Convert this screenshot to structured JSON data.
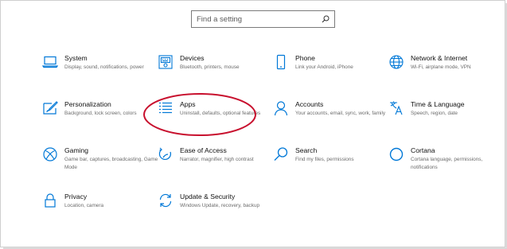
{
  "search": {
    "placeholder": "Find a setting",
    "icon": "search-icon"
  },
  "accent_color": "#0078d7",
  "annotation_color": "#c8102e",
  "tiles": [
    {
      "id": "system",
      "title": "System",
      "desc": "Display, sound, notifications, power",
      "icon": "laptop-icon"
    },
    {
      "id": "devices",
      "title": "Devices",
      "desc": "Bluetooth, printers, mouse",
      "icon": "keyboard-icon"
    },
    {
      "id": "phone",
      "title": "Phone",
      "desc": "Link your Android, iPhone",
      "icon": "phone-icon"
    },
    {
      "id": "network",
      "title": "Network & Internet",
      "desc": "Wi-Fi, airplane mode, VPN",
      "icon": "globe-icon"
    },
    {
      "id": "personalization",
      "title": "Personalization",
      "desc": "Background, lock screen, colors",
      "icon": "paintbrush-icon"
    },
    {
      "id": "apps",
      "title": "Apps",
      "desc": "Uninstall, defaults, optional features",
      "icon": "apps-list-icon"
    },
    {
      "id": "accounts",
      "title": "Accounts",
      "desc": "Your accounts, email, sync, work, family",
      "icon": "person-icon"
    },
    {
      "id": "time",
      "title": "Time & Language",
      "desc": "Speech, region, date",
      "icon": "language-icon"
    },
    {
      "id": "gaming",
      "title": "Gaming",
      "desc": "Game bar, captures, broadcasting, Game Mode",
      "icon": "xbox-icon"
    },
    {
      "id": "ease",
      "title": "Ease of Access",
      "desc": "Narrator, magnifier, high contrast",
      "icon": "ease-of-access-icon"
    },
    {
      "id": "search",
      "title": "Search",
      "desc": "Find my files, permissions",
      "icon": "magnifier-icon"
    },
    {
      "id": "cortana",
      "title": "Cortana",
      "desc": "Cortana language, permissions, notifications",
      "icon": "cortana-circle-icon"
    },
    {
      "id": "privacy",
      "title": "Privacy",
      "desc": "Location, camera",
      "icon": "lock-icon"
    },
    {
      "id": "update",
      "title": "Update & Security",
      "desc": "Windows Update, recovery, backup",
      "icon": "sync-arrows-icon"
    }
  ]
}
